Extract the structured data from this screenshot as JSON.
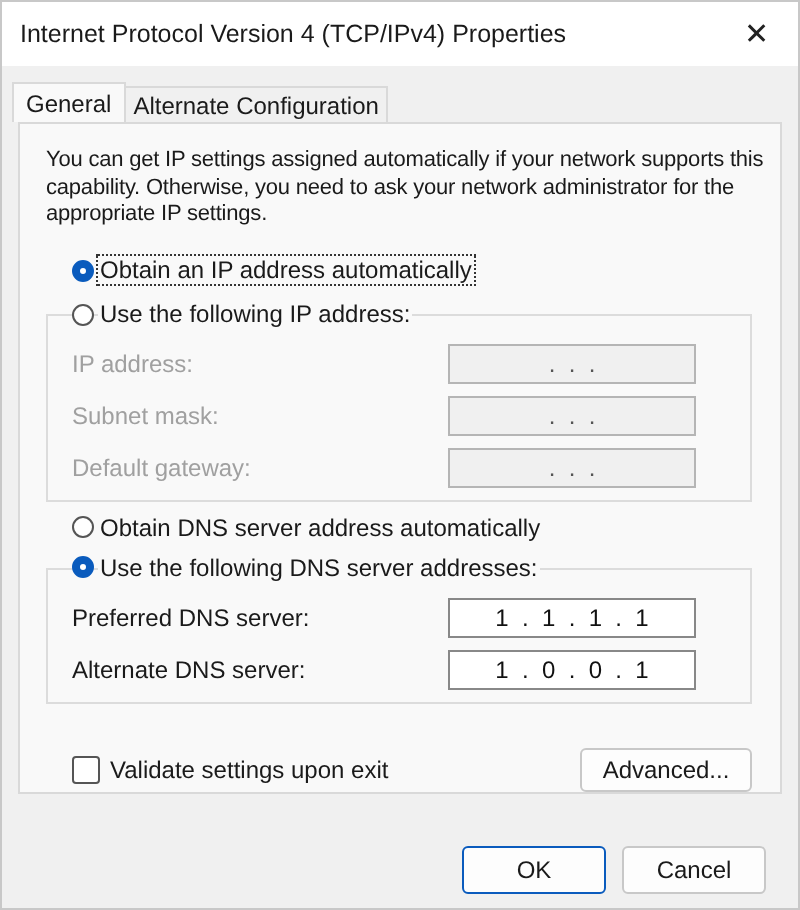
{
  "window": {
    "title": "Internet Protocol Version 4 (TCP/IPv4) Properties",
    "close": "✕"
  },
  "tabs": [
    {
      "label": "General",
      "selected": true
    },
    {
      "label": "Alternate Configuration",
      "selected": false
    }
  ],
  "description": "You can get IP settings assigned automatically if your network supports this capability. Otherwise, you need to ask your network administrator for the appropriate IP settings.",
  "ip_mode": [
    {
      "label": "Obtain an IP address automatically",
      "selected": true,
      "focused": true
    },
    {
      "label": "Use the following IP address:",
      "selected": false,
      "focused": false
    }
  ],
  "ip_fields": [
    {
      "label": "IP address:",
      "value": ".  .  .",
      "disabled": true
    },
    {
      "label": "Subnet mask:",
      "value": ".  .  .",
      "disabled": true
    },
    {
      "label": "Default gateway:",
      "value": ".  .  .",
      "disabled": true
    }
  ],
  "dns_mode": [
    {
      "label": "Obtain DNS server address automatically",
      "selected": false,
      "focused": false
    },
    {
      "label": "Use the following DNS server addresses:",
      "selected": true,
      "focused": false
    }
  ],
  "dns_fields": [
    {
      "label": "Preferred DNS server:",
      "value": "1  .  1  .  1  .  1",
      "disabled": false
    },
    {
      "label": "Alternate DNS server:",
      "value": "1  .  0  .  0  .  1",
      "disabled": false
    }
  ],
  "validate": {
    "label": "Validate settings upon exit",
    "checked": false
  },
  "advanced_button": "Advanced...",
  "buttons": [
    {
      "label": "OK",
      "default": true
    },
    {
      "label": "Cancel",
      "default": false
    }
  ]
}
